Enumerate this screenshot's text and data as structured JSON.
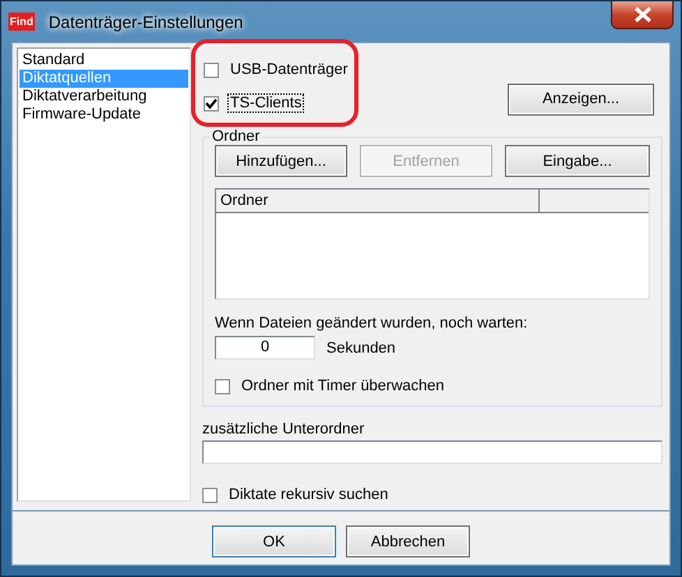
{
  "window": {
    "title": "Datenträger-Einstellungen",
    "icon_text": "Find"
  },
  "sidebar": {
    "items": [
      {
        "label": "Standard",
        "selected": false
      },
      {
        "label": "Diktatquellen",
        "selected": true
      },
      {
        "label": "Diktatverarbeitung",
        "selected": false
      },
      {
        "label": "Firmware-Update",
        "selected": false
      }
    ]
  },
  "sources": [
    {
      "label": "USB-Datenträger",
      "checked": false,
      "focused": false
    },
    {
      "label": "TS-Clients",
      "checked": true,
      "focused": true
    }
  ],
  "show_button": {
    "label": "Anzeigen...",
    "disabled": false
  },
  "folder_group": {
    "title": "Ordner",
    "buttons": [
      {
        "label": "Hinzufügen...",
        "disabled": false
      },
      {
        "label": "Entfernen",
        "disabled": true
      },
      {
        "label": "Eingabe...",
        "disabled": false
      }
    ],
    "list": {
      "columns": [
        {
          "label": "Ordner"
        }
      ]
    },
    "wait": {
      "label": "Wenn Dateien geändert wurden, noch warten:",
      "value": "0",
      "unit": "Sekunden"
    },
    "timer": {
      "label": "Ordner mit Timer überwachen",
      "checked": false
    }
  },
  "subfolders": {
    "label": "zusätzliche Unterordner"
  },
  "recursive": {
    "label": "Diktate rekursiv suchen",
    "checked": false
  },
  "buttons": [
    {
      "label": "OK",
      "default": true
    },
    {
      "label": "Abbrechen",
      "default": false
    }
  ]
}
